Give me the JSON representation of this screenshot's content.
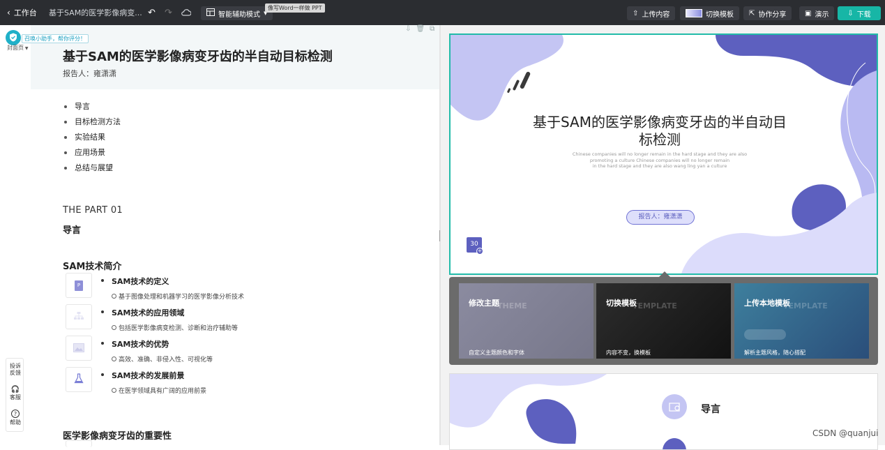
{
  "topbar": {
    "back_label": "工作台",
    "doc_tab": "基于SAM的医学影像病变...",
    "mode_label": "智能辅助模式",
    "mode_tip": "像写Word一样做 PPT",
    "upload_label": "上传内容",
    "switch_template_label": "切换模板",
    "share_label": "协作分享",
    "present_label": "演示",
    "download_label": "下载"
  },
  "assistant": {
    "bubble": "召唤小助手，帮你评分！",
    "page_label": "封面页"
  },
  "outline": {
    "title": "基于SAM的医学影像病变牙齿的半自动目标检测",
    "reporter": "报告人：雍潇潇",
    "toc": [
      "导言",
      "目标检测方法",
      "实验结果",
      "应用场景",
      "总结与展望"
    ],
    "part_label": "THE PART 01",
    "part_title": "导言",
    "section_title": "SAM技术简介",
    "subsections": [
      {
        "title": "SAM技术的定义",
        "desc": "基于图像处理和机器学习的医学影像分析技术"
      },
      {
        "title": "SAM技术的应用领域",
        "desc": "包括医学影像病变检测、诊断和治疗辅助等"
      },
      {
        "title": "SAM技术的优势",
        "desc": "高效、准确、非侵入性、可视化等"
      },
      {
        "title": "SAM技术的发展前景",
        "desc": "在医学领域具有广阔的应用前景"
      }
    ],
    "next_section_title": "医学影像病变牙齿的重要性"
  },
  "float_tools": {
    "feedback": "投诉\n反馈",
    "service": "客服",
    "help": "帮助"
  },
  "slide1": {
    "title_line1": "基于SAM的医学影像病变牙齿的半自动目",
    "title_line2": "标检测",
    "sub_en_1": "Chinese companies will no longer remain in the hard stage and they are also",
    "sub_en_2": "promoting a culture Chinese companies will no longer remain",
    "sub_en_3": "in the hard stage and they are also wang ling yan a culture",
    "reporter_pill": "报告人：雍潇潇",
    "badge": "30"
  },
  "popup": {
    "cards": [
      {
        "title": "修改主题",
        "bg_word": "THEME",
        "desc": "自定义主题颜色和字体"
      },
      {
        "title": "切换模板",
        "bg_word": "TEMPLATE",
        "desc": "内容不变，换模板"
      },
      {
        "title": "上传本地模板",
        "bg_word": "TEMPLATE",
        "desc": "解析主题风格，随心搭配"
      }
    ]
  },
  "slide2": {
    "title": "导言"
  },
  "watermark": "CSDN @quanjui",
  "colors": {
    "accent": "#17b6a6",
    "purple": "#5b5fc7",
    "lavender": "#b7b9f2"
  }
}
